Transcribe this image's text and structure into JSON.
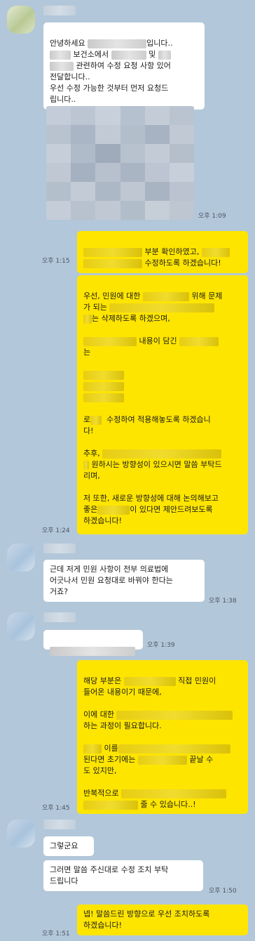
{
  "messages": [
    {
      "id": "m1",
      "dir": "in",
      "lines": [
        "안녕하세요 ",
        "입니다..",
        "보건소에서 ",
        "및",
        "관련하여 수정 요청 사항 있어",
        "전달합니다..",
        "우선 수정 가능한 것부터 먼저 요청드",
        "립니다.."
      ]
    },
    {
      "id": "m2",
      "dir": "in",
      "time": "오후 1:09",
      "image": true
    },
    {
      "id": "m3",
      "dir": "out",
      "time": "오후 1:15",
      "parts": [
        "부분 확인하였고,",
        "수정하도록 하겠습니다!"
      ]
    },
    {
      "id": "m4",
      "dir": "out",
      "time": "오후 1:24",
      "parts": [
        "우선, 민원에 대한",
        "위해 문제",
        "가 되는",
        "는 삭제하도록 하겠으며,",
        "내용이 담긴",
        "는",
        "로",
        "수정하여 적용해놓도록 하겠습니",
        "다!",
        "추후,",
        "원하시는 방향성이 있으시면 말씀 부탁드",
        "리며,",
        "저 또한, 새로운 방향성에 대해 논의해보고",
        "좋은",
        "이 있다면 제안드려보도록",
        "하겠습니다!"
      ]
    },
    {
      "id": "m5",
      "dir": "in",
      "time": "오후 1:38",
      "text": "근데 저게 민원 사항이 전부 의료법에\n어긋나서 민원 요청대로 바꿔야 한다는\n거죠?"
    },
    {
      "id": "m6",
      "dir": "in",
      "time": "오후 1:39"
    },
    {
      "id": "m7",
      "dir": "out",
      "time": "오후 1:45",
      "parts": [
        "해당 부분은",
        "직접 민원이",
        "들어온 내용이기 때문에,",
        "이에 대한",
        "하는 과정이 필요합니다.",
        "이를",
        "된다면 초기에는",
        "끝날 수",
        "도 있지만,",
        "반복적으로",
        "줄 수 있습니다..!"
      ]
    },
    {
      "id": "m8",
      "dir": "in",
      "text": "그렇군요"
    },
    {
      "id": "m9",
      "dir": "in",
      "time": "오후 1:50",
      "text": "그러면 말씀 주신대로 수정 조치 부탁\n드립니다"
    },
    {
      "id": "m10",
      "dir": "out",
      "time": "오후 1:51",
      "text": "넵! 말씀드린 방향으로 우선 조치하도록\n하겠습니다!"
    }
  ],
  "colors": {
    "background": "#b2c7d9",
    "incoming": "#ffffff",
    "outgoing": "#fee500"
  }
}
